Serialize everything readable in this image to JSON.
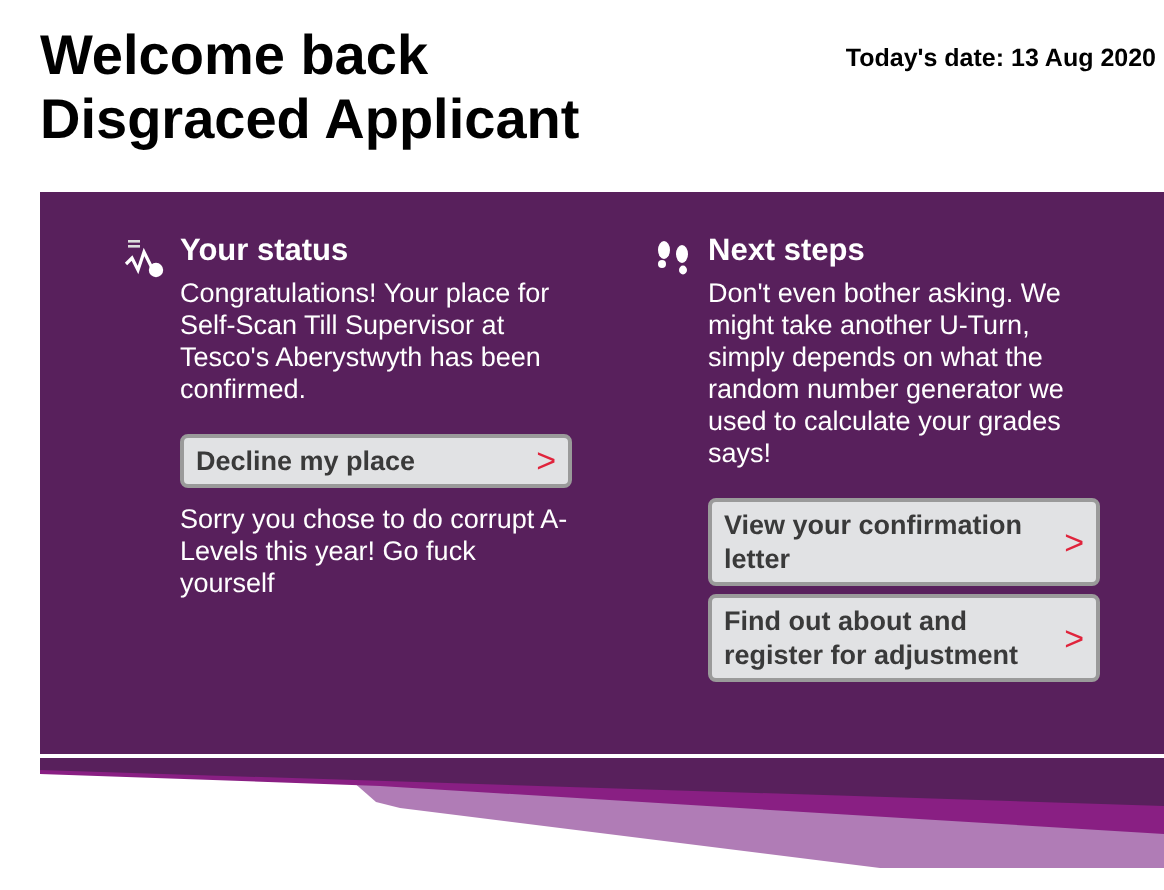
{
  "header": {
    "title_lines": [
      "Welcome back",
      "Disgraced Applicant"
    ],
    "date": "Today's date: 13 Aug 2020"
  },
  "columns": [
    {
      "kind": "status",
      "heading": "Your status",
      "paragraphs": [
        "Congratulations! Your place for Self-Scan Till Supervisor at Tesco's Aberystwyth has been confirmed."
      ],
      "buttons": [
        {
          "label": "Decline my place",
          "arrow": ">"
        }
      ],
      "after": "Sorry you chose to do corrupt A-Levels this year! Go fuck yourself"
    },
    {
      "kind": "steps",
      "heading": "Next steps",
      "paragraphs": [
        "Don't even bother asking. We might take another U-Turn, simply depends on what the random number generator we used to calculate your grades says!"
      ],
      "buttons": [
        {
          "label": "View your confirmation letter",
          "arrow": ">"
        },
        {
          "label": "Find out about and register for adjustment",
          "arrow": ">"
        }
      ]
    }
  ]
}
